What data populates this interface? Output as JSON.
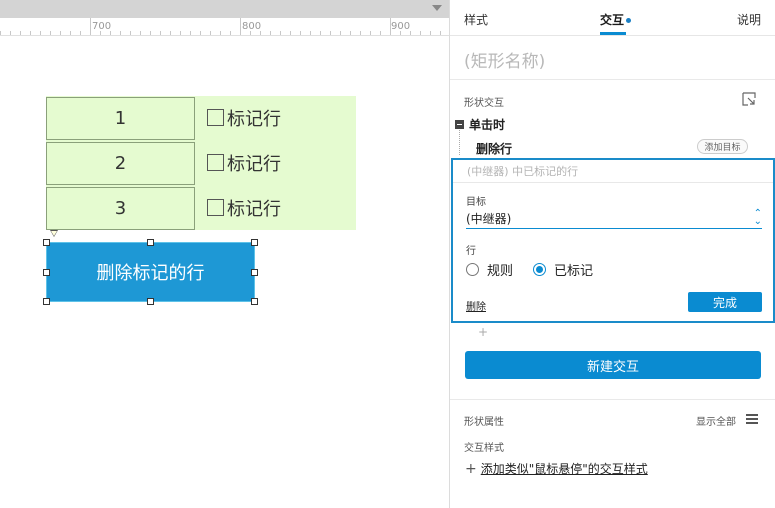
{
  "ruler": {
    "labels": [
      "700",
      "800",
      "900"
    ]
  },
  "canvas": {
    "rows": [
      {
        "number": "1",
        "checkbox_label": "标记行"
      },
      {
        "number": "2",
        "checkbox_label": "标记行"
      },
      {
        "number": "3",
        "checkbox_label": "标记行"
      }
    ],
    "delete_button_label": "删除标记的行"
  },
  "panel": {
    "tabs": {
      "style": "样式",
      "interaction": "交互",
      "notes": "说明"
    },
    "shape_name_placeholder": "(矩形名称)",
    "shape_interactions_label": "形状交互",
    "event_label": "单击时",
    "action_label": "删除行",
    "add_target_label": "添加目标",
    "editor": {
      "summary": "(中继器) 中已标记的行",
      "target_label": "目标",
      "target_value": "(中继器)",
      "row_label": "行",
      "options": [
        {
          "label": "规则",
          "checked": false
        },
        {
          "label": "已标记",
          "checked": true
        }
      ],
      "delete_label": "删除",
      "done_label": "完成"
    },
    "new_interaction_label": "新建交互",
    "shape_props_label": "形状属性",
    "show_all_label": "显示全部",
    "interaction_style_label": "交互样式",
    "add_style_label": "添加类似\"鼠标悬停\"的交互样式"
  },
  "colors": {
    "accent": "#0a8bd1",
    "button_fill": "#1e98d5",
    "repeater_fill": "#e5fbd0"
  }
}
